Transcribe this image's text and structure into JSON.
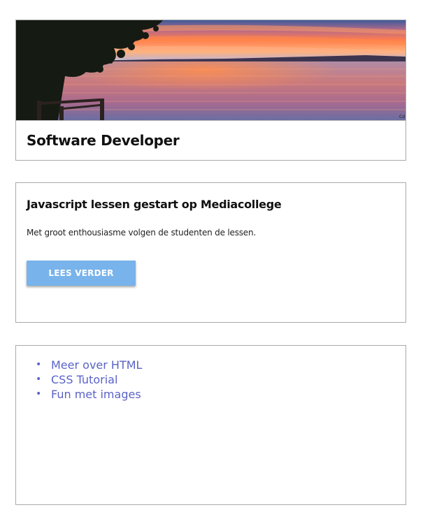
{
  "header_card": {
    "image_alt": "sunset over lake",
    "title": "Software Developer"
  },
  "news_card": {
    "title": "Javascript lessen gestart op Mediacollege",
    "text": "Met groot enthousiasme volgen de studenten de lessen.",
    "button_label": "LEES VERDER"
  },
  "links_card": {
    "items": [
      {
        "label": "Meer over HTML"
      },
      {
        "label": "CSS Tutorial"
      },
      {
        "label": "Fun met images"
      }
    ]
  },
  "colors": {
    "button_bg": "#78b3eb",
    "link": "#5a63c6",
    "border": "#a9a9a9"
  }
}
